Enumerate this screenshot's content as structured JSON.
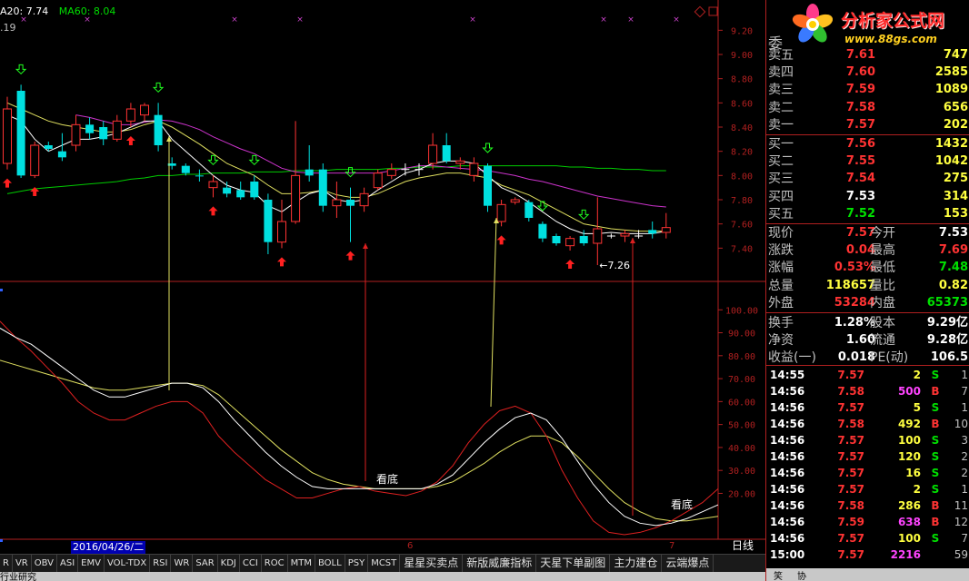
{
  "legend": {
    "ma20": "A20: 7.74",
    "ma60": "MA60: 8.04",
    "sub": ".19"
  },
  "price_axis": [
    "9.20",
    "9.00",
    "8.80",
    "8.60",
    "8.40",
    "8.20",
    "8.00",
    "7.80",
    "7.60",
    "7.40"
  ],
  "ind_axis": [
    "100.00",
    "90.00",
    "80.00",
    "70.00",
    "60.00",
    "50.00",
    "40.00",
    "30.00",
    "20.00"
  ],
  "annotations": {
    "low_price": "←7.26",
    "look_bottom_1": "看底",
    "look_bottom_2": "看底"
  },
  "date_label": "2016/04/26/二",
  "month_marks": [
    "6",
    "7"
  ],
  "period_label": "日线",
  "tabs": [
    "R",
    "VR",
    "OBV",
    "ASI",
    "EMV",
    "VOL-TDX",
    "RSI",
    "WR",
    "SAR",
    "KDJ",
    "CCI",
    "ROC",
    "MTM",
    "BOLL",
    "PSY",
    "MCST",
    "星星买卖点",
    "新版威廉指标",
    "天星下单副图",
    "主力建仓",
    "云端爆点"
  ],
  "status_text": "行业研究",
  "brand": {
    "title": "分析家公式网",
    "url": "www.88gs.com"
  },
  "weibi_label": "委",
  "order_book": {
    "sells": [
      {
        "label": "卖五",
        "price": "7.61",
        "vol": "747"
      },
      {
        "label": "卖四",
        "price": "7.60",
        "vol": "2585"
      },
      {
        "label": "卖三",
        "price": "7.59",
        "vol": "1089"
      },
      {
        "label": "卖二",
        "price": "7.58",
        "vol": "656"
      },
      {
        "label": "卖一",
        "price": "7.57",
        "vol": "202"
      }
    ],
    "buys": [
      {
        "label": "买一",
        "price": "7.56",
        "vol": "1432"
      },
      {
        "label": "买二",
        "price": "7.55",
        "vol": "1042"
      },
      {
        "label": "买三",
        "price": "7.54",
        "vol": "275"
      },
      {
        "label": "买四",
        "price": "7.53",
        "vol": "314"
      },
      {
        "label": "买五",
        "price": "7.52",
        "vol": "153"
      }
    ]
  },
  "quote": [
    {
      "l1": "现价",
      "v1": "7.57",
      "c1": "red",
      "l2": "今开",
      "v2": "7.53",
      "c2": "white"
    },
    {
      "l1": "涨跌",
      "v1": "0.04",
      "c1": "red",
      "l2": "最高",
      "v2": "7.69",
      "c2": "red"
    },
    {
      "l1": "涨幅",
      "v1": "0.53%",
      "c1": "red",
      "l2": "最低",
      "v2": "7.48",
      "c2": "green"
    },
    {
      "l1": "总量",
      "v1": "118657",
      "c1": "yellow",
      "l2": "量比",
      "v2": "0.82",
      "c2": "yellow"
    },
    {
      "l1": "外盘",
      "v1": "53284",
      "c1": "red",
      "l2": "内盘",
      "v2": "65373",
      "c2": "green"
    },
    {
      "l1": "换手",
      "v1": "1.28%",
      "c1": "white",
      "l2": "股本",
      "v2": "9.29亿",
      "c2": "white"
    },
    {
      "l1": "净资",
      "v1": "1.60",
      "c1": "white",
      "l2": "流通",
      "v2": "9.28亿",
      "c2": "white"
    },
    {
      "l1": "收益(一)",
      "v1": "0.018",
      "c1": "white",
      "l2": "PE(动)",
      "v2": "106.5",
      "c2": "white"
    }
  ],
  "ticks": [
    {
      "time": "14:55",
      "price": "7.57",
      "pc": "red",
      "vol": "2",
      "vc": "yellow",
      "bs": "S",
      "bc": "green",
      "n": "1"
    },
    {
      "time": "14:56",
      "price": "7.58",
      "pc": "red",
      "vol": "500",
      "vc": "magenta",
      "bs": "B",
      "bc": "red",
      "n": "7"
    },
    {
      "time": "14:56",
      "price": "7.57",
      "pc": "red",
      "vol": "5",
      "vc": "yellow",
      "bs": "S",
      "bc": "green",
      "n": "1"
    },
    {
      "time": "14:56",
      "price": "7.58",
      "pc": "red",
      "vol": "492",
      "vc": "yellow",
      "bs": "B",
      "bc": "red",
      "n": "10"
    },
    {
      "time": "14:56",
      "price": "7.57",
      "pc": "red",
      "vol": "100",
      "vc": "yellow",
      "bs": "S",
      "bc": "green",
      "n": "3"
    },
    {
      "time": "14:56",
      "price": "7.57",
      "pc": "red",
      "vol": "120",
      "vc": "yellow",
      "bs": "S",
      "bc": "green",
      "n": "2"
    },
    {
      "time": "14:56",
      "price": "7.57",
      "pc": "red",
      "vol": "16",
      "vc": "yellow",
      "bs": "S",
      "bc": "green",
      "n": "2"
    },
    {
      "time": "14:56",
      "price": "7.57",
      "pc": "red",
      "vol": "2",
      "vc": "yellow",
      "bs": "S",
      "bc": "green",
      "n": "1"
    },
    {
      "time": "14:56",
      "price": "7.58",
      "pc": "red",
      "vol": "286",
      "vc": "yellow",
      "bs": "B",
      "bc": "red",
      "n": "11"
    },
    {
      "time": "14:56",
      "price": "7.59",
      "pc": "red",
      "vol": "638",
      "vc": "magenta",
      "bs": "B",
      "bc": "red",
      "n": "12"
    },
    {
      "time": "14:56",
      "price": "7.57",
      "pc": "red",
      "vol": "100",
      "vc": "yellow",
      "bs": "S",
      "bc": "green",
      "n": "7"
    },
    {
      "time": "15:00",
      "price": "7.57",
      "pc": "red",
      "vol": "2216",
      "vc": "magenta",
      "bs": "",
      "bc": "white",
      "n": "59"
    }
  ],
  "bottom_bar": {
    "item1": "笑",
    "item2": "协"
  },
  "colors": {
    "up": "#ff3333",
    "down": "#00e0e0",
    "ma_white": "#ffffff",
    "ma_yellow": "#e0e060",
    "ma_magenta": "#cc33cc",
    "ma_green": "#00cc00",
    "frame": "#b02020"
  },
  "chart_data": {
    "type": "candlestick",
    "price_range": [
      7.2,
      9.3
    ],
    "candles": [
      {
        "o": 8.1,
        "h": 8.65,
        "l": 8.05,
        "c": 8.55,
        "dir": "up"
      },
      {
        "o": 8.7,
        "h": 8.75,
        "l": 7.98,
        "c": 8.0,
        "dir": "down"
      },
      {
        "o": 8.0,
        "h": 8.28,
        "l": 7.98,
        "c": 8.25,
        "dir": "up"
      },
      {
        "o": 8.25,
        "h": 8.28,
        "l": 8.2,
        "c": 8.22,
        "dir": "down"
      },
      {
        "o": 8.15,
        "h": 8.35,
        "l": 8.12,
        "c": 8.2,
        "dir": "down"
      },
      {
        "o": 8.25,
        "h": 8.5,
        "l": 8.2,
        "c": 8.42,
        "dir": "up"
      },
      {
        "o": 8.42,
        "h": 8.48,
        "l": 8.3,
        "c": 8.35,
        "dir": "down"
      },
      {
        "o": 8.4,
        "h": 8.45,
        "l": 8.25,
        "c": 8.3,
        "dir": "down"
      },
      {
        "o": 8.3,
        "h": 8.5,
        "l": 8.28,
        "c": 8.45,
        "dir": "up"
      },
      {
        "o": 8.45,
        "h": 8.6,
        "l": 8.4,
        "c": 8.55,
        "dir": "up"
      },
      {
        "o": 8.5,
        "h": 8.6,
        "l": 8.45,
        "c": 8.58,
        "dir": "up"
      },
      {
        "o": 8.5,
        "h": 8.6,
        "l": 8.2,
        "c": 8.25,
        "dir": "down"
      },
      {
        "o": 8.1,
        "h": 8.15,
        "l": 8.05,
        "c": 8.08,
        "dir": "down"
      },
      {
        "o": 8.08,
        "h": 8.1,
        "l": 8.0,
        "c": 8.02,
        "dir": "down"
      },
      {
        "o": 8.0,
        "h": 8.05,
        "l": 7.95,
        "c": 8.0,
        "dir": "down"
      },
      {
        "o": 7.95,
        "h": 8.0,
        "l": 7.82,
        "c": 7.9,
        "dir": "up"
      },
      {
        "o": 7.9,
        "h": 7.95,
        "l": 7.82,
        "c": 7.85,
        "dir": "down"
      },
      {
        "o": 7.88,
        "h": 7.95,
        "l": 7.8,
        "c": 7.82,
        "dir": "down"
      },
      {
        "o": 7.95,
        "h": 8.0,
        "l": 7.8,
        "c": 7.82,
        "dir": "down"
      },
      {
        "o": 7.8,
        "h": 7.85,
        "l": 7.35,
        "c": 7.45,
        "dir": "down"
      },
      {
        "o": 7.45,
        "h": 7.8,
        "l": 7.4,
        "c": 7.62,
        "dir": "up"
      },
      {
        "o": 7.62,
        "h": 8.45,
        "l": 7.6,
        "c": 8.0,
        "dir": "up"
      },
      {
        "o": 8.0,
        "h": 8.25,
        "l": 7.95,
        "c": 8.05,
        "dir": "down"
      },
      {
        "o": 8.05,
        "h": 8.1,
        "l": 7.7,
        "c": 7.75,
        "dir": "down"
      },
      {
        "o": 7.75,
        "h": 7.95,
        "l": 7.65,
        "c": 7.8,
        "dir": "up"
      },
      {
        "o": 7.8,
        "h": 7.9,
        "l": 7.45,
        "c": 7.75,
        "dir": "down"
      },
      {
        "o": 7.75,
        "h": 7.9,
        "l": 7.7,
        "c": 7.85,
        "dir": "up"
      },
      {
        "o": 7.9,
        "h": 8.05,
        "l": 7.88,
        "c": 8.02,
        "dir": "up"
      },
      {
        "o": 8.0,
        "h": 8.1,
        "l": 7.97,
        "c": 8.05,
        "dir": "up"
      },
      {
        "o": 8.05,
        "h": 8.1,
        "l": 8.0,
        "c": 8.05,
        "dir": "flat"
      },
      {
        "o": 8.05,
        "h": 8.1,
        "l": 8.0,
        "c": 8.05,
        "dir": "flat"
      },
      {
        "o": 8.1,
        "h": 8.35,
        "l": 8.05,
        "c": 8.25,
        "dir": "up"
      },
      {
        "o": 8.25,
        "h": 8.35,
        "l": 8.1,
        "c": 8.12,
        "dir": "down"
      },
      {
        "o": 8.12,
        "h": 8.15,
        "l": 8.05,
        "c": 8.1,
        "dir": "up"
      },
      {
        "o": 8.1,
        "h": 8.15,
        "l": 7.95,
        "c": 8.0,
        "dir": "up"
      },
      {
        "o": 8.08,
        "h": 8.1,
        "l": 7.7,
        "c": 7.75,
        "dir": "down"
      },
      {
        "o": 7.62,
        "h": 7.8,
        "l": 7.58,
        "c": 7.76,
        "dir": "up"
      },
      {
        "o": 7.78,
        "h": 7.82,
        "l": 7.76,
        "c": 7.8,
        "dir": "up"
      },
      {
        "o": 7.78,
        "h": 7.8,
        "l": 7.62,
        "c": 7.65,
        "dir": "down"
      },
      {
        "o": 7.6,
        "h": 7.62,
        "l": 7.45,
        "c": 7.48,
        "dir": "down"
      },
      {
        "o": 7.5,
        "h": 7.52,
        "l": 7.42,
        "c": 7.44,
        "dir": "down"
      },
      {
        "o": 7.42,
        "h": 7.5,
        "l": 7.38,
        "c": 7.48,
        "dir": "up"
      },
      {
        "o": 7.5,
        "h": 7.55,
        "l": 7.42,
        "c": 7.44,
        "dir": "down"
      },
      {
        "o": 7.44,
        "h": 7.82,
        "l": 7.26,
        "c": 7.56,
        "dir": "up"
      },
      {
        "o": 7.5,
        "h": 7.52,
        "l": 7.48,
        "c": 7.5,
        "dir": "flat"
      },
      {
        "o": 7.5,
        "h": 7.55,
        "l": 7.45,
        "c": 7.52,
        "dir": "up"
      },
      {
        "o": 7.5,
        "h": 7.55,
        "l": 7.48,
        "c": 7.5,
        "dir": "flat"
      },
      {
        "o": 7.52,
        "h": 7.62,
        "l": 7.48,
        "c": 7.55,
        "dir": "down"
      },
      {
        "o": 7.53,
        "h": 7.69,
        "l": 7.48,
        "c": 7.57,
        "dir": "up"
      }
    ],
    "ma_white": [
      8.5,
      8.45,
      8.3,
      8.2,
      8.25,
      8.3,
      8.3,
      8.32,
      8.35,
      8.4,
      8.45,
      8.45,
      8.3,
      8.2,
      8.1,
      8.0,
      7.92,
      7.88,
      7.86,
      7.75,
      7.7,
      7.78,
      7.85,
      7.88,
      7.8,
      7.78,
      7.8,
      7.88,
      7.95,
      8.02,
      8.05,
      8.1,
      8.12,
      8.12,
      8.1,
      8.0,
      7.9,
      7.85,
      7.78,
      7.7,
      7.62,
      7.56,
      7.52,
      7.52,
      7.53,
      7.52,
      7.52,
      7.52,
      7.54
    ],
    "ma_yellow": [
      8.6,
      8.55,
      8.5,
      8.45,
      8.42,
      8.4,
      8.38,
      8.36,
      8.36,
      8.38,
      8.42,
      8.45,
      8.4,
      8.33,
      8.26,
      8.18,
      8.1,
      8.05,
      8.0,
      7.92,
      7.85,
      7.85,
      7.86,
      7.88,
      7.84,
      7.82,
      7.82,
      7.85,
      7.9,
      7.95,
      7.98,
      8.0,
      8.02,
      8.02,
      8.0,
      7.98,
      7.92,
      7.88,
      7.84,
      7.78,
      7.72,
      7.66,
      7.6,
      7.58,
      7.56,
      7.55,
      7.54,
      7.54,
      7.54
    ],
    "ma_magenta": [
      null,
      null,
      null,
      null,
      null,
      8.5,
      8.48,
      8.45,
      8.42,
      8.42,
      8.44,
      8.46,
      8.45,
      8.42,
      8.38,
      8.32,
      8.27,
      8.22,
      8.18,
      8.12,
      8.06,
      8.03,
      8.02,
      8.02,
      8.02,
      8.02,
      8.02,
      8.02,
      8.04,
      8.06,
      8.08,
      8.08,
      8.07,
      8.06,
      8.05,
      8.04,
      8.02,
      8.0,
      7.97,
      7.95,
      7.92,
      7.89,
      7.86,
      7.83,
      7.81,
      7.79,
      7.77,
      7.75,
      7.74
    ],
    "ma_green": [
      7.85,
      7.87,
      7.89,
      7.9,
      7.91,
      7.92,
      7.93,
      7.94,
      7.95,
      7.97,
      7.98,
      8.0,
      8.0,
      8.01,
      8.01,
      8.02,
      8.02,
      8.02,
      8.03,
      8.03,
      8.03,
      8.04,
      8.04,
      8.04,
      8.05,
      8.05,
      8.05,
      8.05,
      8.06,
      8.06,
      8.07,
      8.07,
      8.07,
      8.08,
      8.08,
      8.08,
      8.08,
      8.08,
      8.08,
      8.08,
      8.08,
      8.07,
      8.07,
      8.06,
      8.06,
      8.05,
      8.05,
      8.04,
      8.04
    ],
    "indicator_range": [
      0,
      110
    ],
    "ind_red": [
      95,
      88,
      82,
      75,
      68,
      60,
      55,
      52,
      52,
      55,
      58,
      60,
      60,
      55,
      45,
      38,
      32,
      26,
      22,
      18,
      18,
      20,
      22,
      23,
      21,
      20,
      19,
      21,
      25,
      32,
      42,
      50,
      56,
      58,
      55,
      45,
      30,
      18,
      8,
      3,
      2,
      3,
      5,
      8,
      12,
      16,
      22
    ],
    "ind_white": [
      92,
      88,
      85,
      80,
      75,
      70,
      65,
      62,
      62,
      64,
      66,
      68,
      68,
      66,
      60,
      52,
      45,
      38,
      32,
      27,
      23,
      22,
      22,
      22,
      22,
      22,
      22,
      22,
      24,
      28,
      35,
      42,
      48,
      53,
      55,
      52,
      44,
      34,
      24,
      16,
      10,
      7,
      6,
      7,
      9,
      12,
      15
    ],
    "ind_yellow": [
      78,
      76,
      74,
      72,
      70,
      68,
      66,
      65,
      65,
      66,
      67,
      68,
      68,
      67,
      63,
      57,
      51,
      45,
      39,
      34,
      29,
      26,
      24,
      23,
      22,
      22,
      22,
      22,
      23,
      25,
      29,
      33,
      38,
      42,
      45,
      45,
      42,
      36,
      29,
      22,
      16,
      12,
      9,
      8,
      8,
      9,
      10
    ]
  }
}
